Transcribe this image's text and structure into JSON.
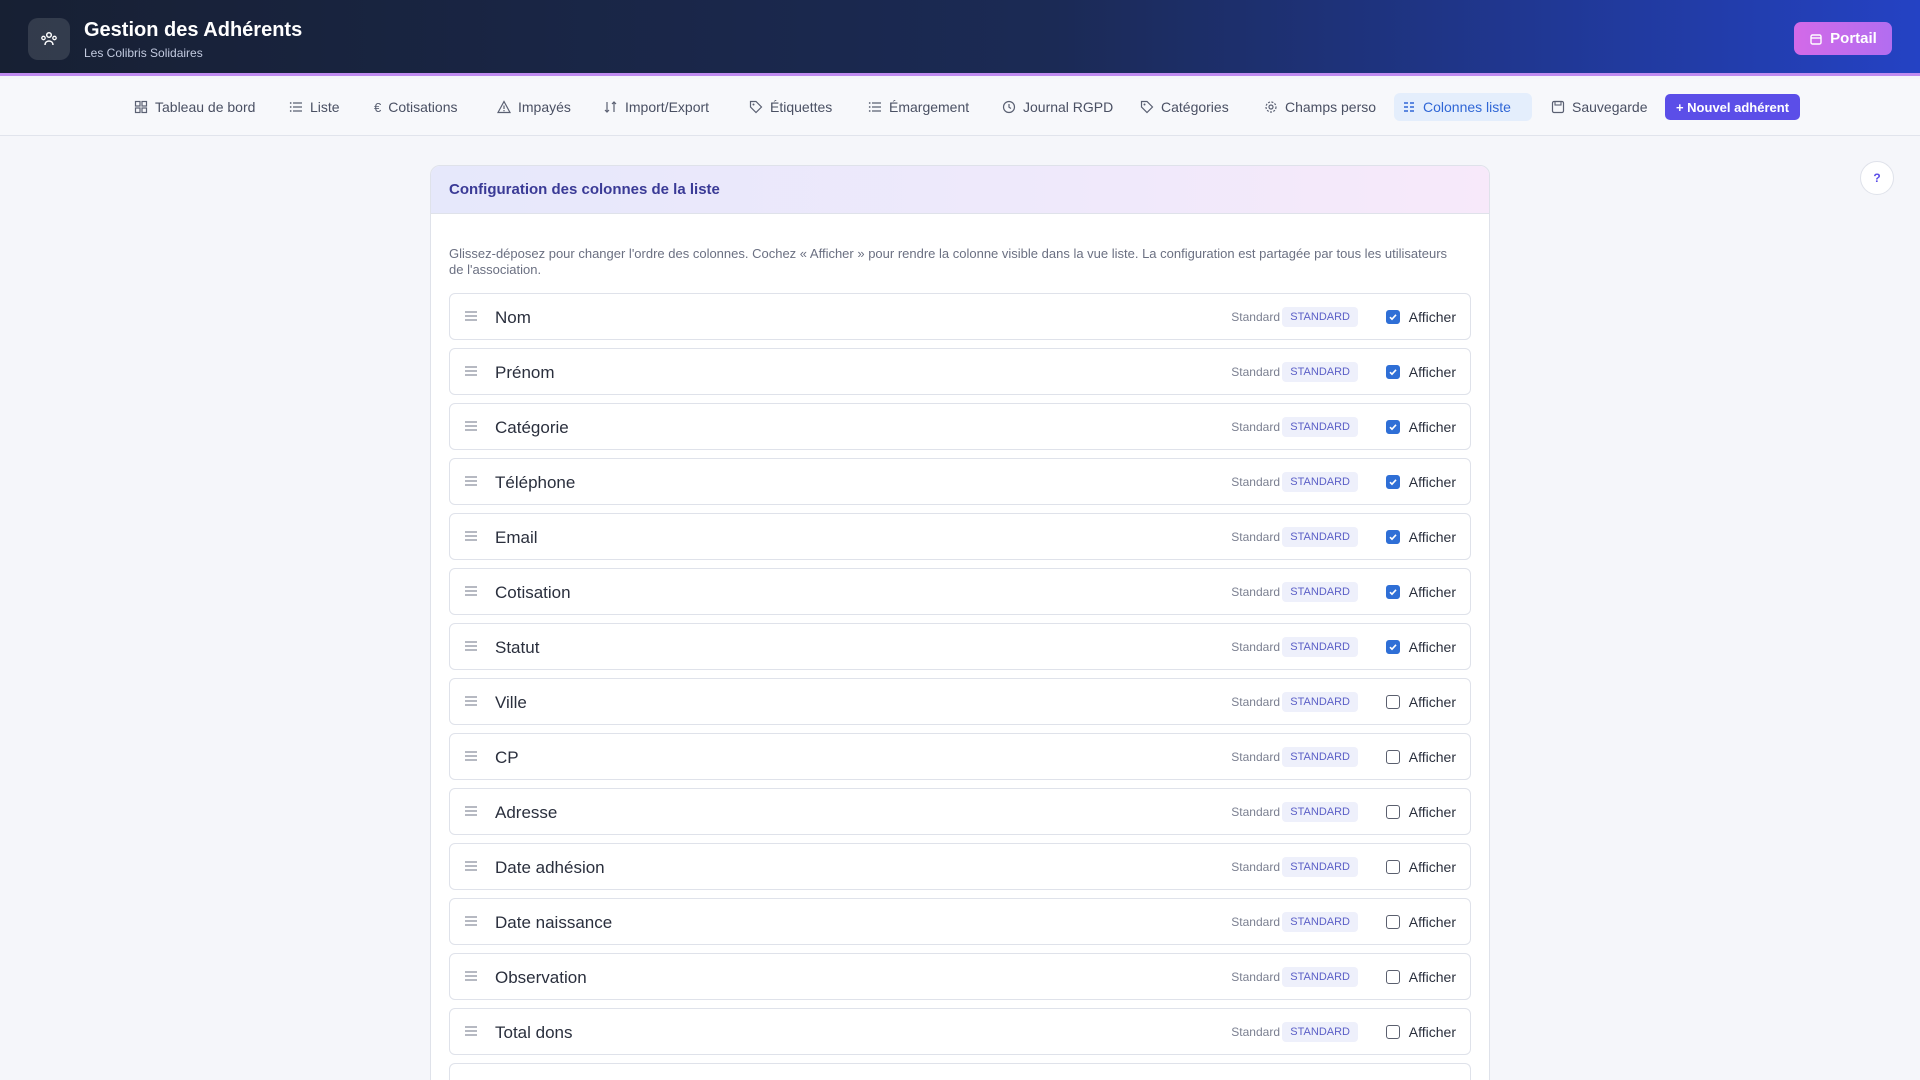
{
  "header": {
    "title": "Gestion des Adhérents",
    "subtitle": "Les Colibris Solidaires",
    "portal_label": "Portail"
  },
  "nav": {
    "items": [
      {
        "label": "Tableau de bord",
        "icon": "grid-icon"
      },
      {
        "label": "Liste",
        "icon": "list-icon"
      },
      {
        "label": "Cotisations",
        "icon": "euro-icon"
      },
      {
        "label": "Impayés",
        "icon": "warning-icon"
      },
      {
        "label": "Import/Export",
        "icon": "import-export-icon"
      },
      {
        "label": "Étiquettes",
        "icon": "tag-icon"
      },
      {
        "label": "Émargement",
        "icon": "list-icon"
      },
      {
        "label": "Journal RGPD",
        "icon": "history-icon"
      },
      {
        "label": "Catégories",
        "icon": "tag-icon"
      },
      {
        "label": "Champs perso",
        "icon": "gear-icon"
      },
      {
        "label": "Colonnes liste",
        "icon": "columns-icon"
      },
      {
        "label": "Sauvegarde",
        "icon": "save-icon"
      }
    ],
    "active": "Colonnes liste",
    "new_button": "+ Nouvel adhérent"
  },
  "help_label": "?",
  "card": {
    "title": "Configuration des colonnes de la liste",
    "description": "Glissez-déposez pour changer l'ordre des colonnes. Cochez « Afficher » pour rendre la colonne visible dans la vue liste. La configuration est partagée par tous les utilisateurs de l'association.",
    "show_label": "Afficher",
    "rows": [
      {
        "name": "Nom",
        "type": "Standard",
        "badge": "STANDARD",
        "visible": true
      },
      {
        "name": "Prénom",
        "type": "Standard",
        "badge": "STANDARD",
        "visible": true
      },
      {
        "name": "Catégorie",
        "type": "Standard",
        "badge": "STANDARD",
        "visible": true
      },
      {
        "name": "Téléphone",
        "type": "Standard",
        "badge": "STANDARD",
        "visible": true
      },
      {
        "name": "Email",
        "type": "Standard",
        "badge": "STANDARD",
        "visible": true
      },
      {
        "name": "Cotisation",
        "type": "Standard",
        "badge": "STANDARD",
        "visible": true
      },
      {
        "name": "Statut",
        "type": "Standard",
        "badge": "STANDARD",
        "visible": true
      },
      {
        "name": "Ville",
        "type": "Standard",
        "badge": "STANDARD",
        "visible": false
      },
      {
        "name": "CP",
        "type": "Standard",
        "badge": "STANDARD",
        "visible": false
      },
      {
        "name": "Adresse",
        "type": "Standard",
        "badge": "STANDARD",
        "visible": false
      },
      {
        "name": "Date adhésion",
        "type": "Standard",
        "badge": "STANDARD",
        "visible": false
      },
      {
        "name": "Date naissance",
        "type": "Standard",
        "badge": "STANDARD",
        "visible": false
      },
      {
        "name": "Observation",
        "type": "Standard",
        "badge": "STANDARD",
        "visible": false
      },
      {
        "name": "Total dons",
        "type": "Standard",
        "badge": "STANDARD",
        "visible": false
      }
    ]
  }
}
